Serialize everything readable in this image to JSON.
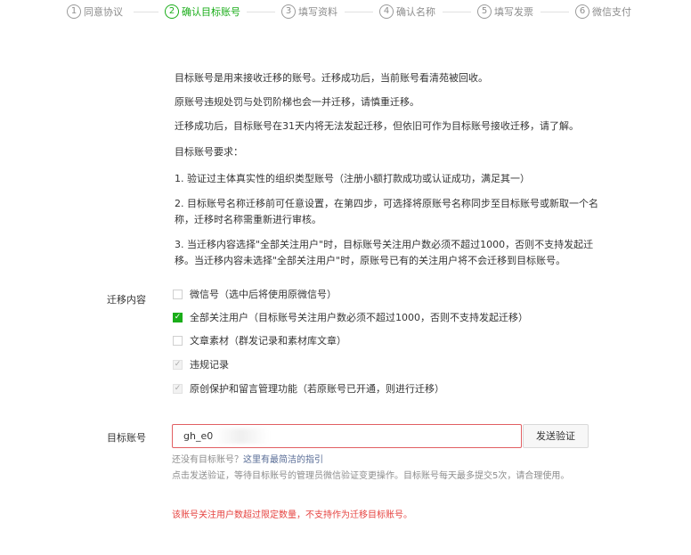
{
  "steps": [
    {
      "num": "1",
      "label": "同意协议",
      "active": false
    },
    {
      "num": "2",
      "label": "确认目标账号",
      "active": true
    },
    {
      "num": "3",
      "label": "填写资料",
      "active": false
    },
    {
      "num": "4",
      "label": "确认名称",
      "active": false
    },
    {
      "num": "5",
      "label": "填写发票",
      "active": false
    },
    {
      "num": "6",
      "label": "微信支付",
      "active": false
    }
  ],
  "info": {
    "p1": "目标账号是用来接收迁移的账号。迁移成功后，当前账号看清苑被回收。",
    "p2": "原账号违规处罚与处罚阶梯也会一并迁移，请慎重迁移。",
    "p3": "迁移成功后，目标账号在31天内将无法发起迁移，但依旧可作为目标账号接收迁移，请了解。",
    "p4": "目标账号要求：",
    "p5": "1. 验证过主体真实性的组织类型账号（注册小额打款成功或认证成功，满足其一）",
    "p6": "2. 目标账号名称迁移前可任意设置，在第四步，可选择将原账号名称同步至目标账号或新取一个名称，迁移时名称需重新进行审核。",
    "p7": "3. 当迁移内容选择\"全部关注用户\"时，目标账号关注用户数必须不超过1000，否则不支持发起迁移。当迁移内容未选择\"全部关注用户\"时，原账号已有的关注用户将不会迁移到目标账号。"
  },
  "migration": {
    "label": "迁移内容",
    "options": [
      {
        "label": "微信号（选中后将使用原微信号）",
        "state": "unchecked"
      },
      {
        "label": "全部关注用户（目标账号关注用户数必须不超过1000，否则不支持发起迁移）",
        "state": "checked"
      },
      {
        "label": "文章素材（群发记录和素材库文章）",
        "state": "unchecked"
      },
      {
        "label": "违规记录",
        "state": "disabled-checked"
      },
      {
        "label": "原创保护和留言管理功能（若原账号已开通，则进行迁移）",
        "state": "disabled-checked"
      }
    ]
  },
  "target": {
    "label": "目标账号",
    "input_value": "gh_e0",
    "send_button": "发送验证",
    "hint_prefix": "还没有目标账号？",
    "hint_link": "这里有最简洁的指引",
    "hint_text": "点击发送验证，等待目标账号的管理员微信验证变更操作。目标账号每天最多提交5次，请合理使用。",
    "error": "该账号关注用户数超过限定数量，不支持作为迁移目标账号。"
  },
  "colors": {
    "accent": "#1aad19",
    "error": "#e64340",
    "link": "#576b95"
  },
  "icons": {
    "check": "check-icon"
  }
}
